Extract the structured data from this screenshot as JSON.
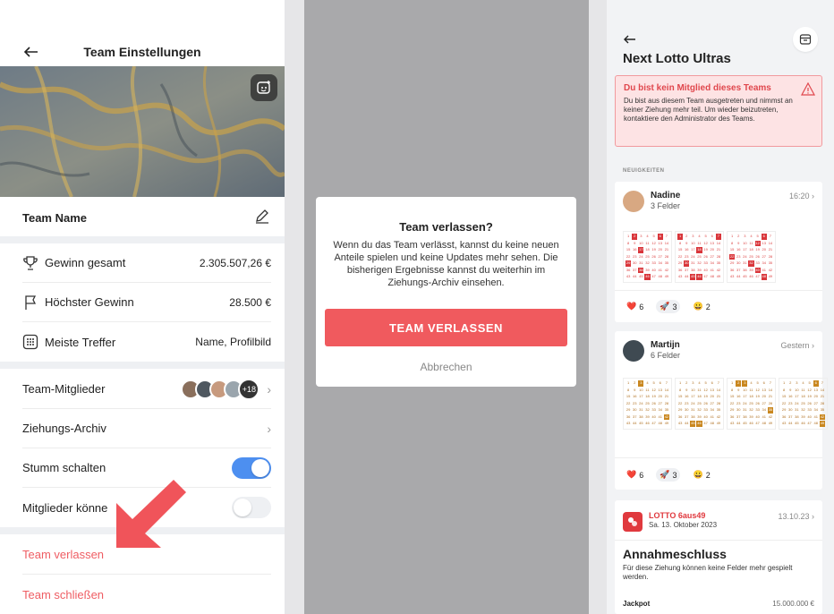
{
  "settings": {
    "title": "Team Einstellungen",
    "team_name_label": "Team Name",
    "stats": [
      {
        "label": "Gewinn gesamt",
        "value": "2.305.507,26 €"
      },
      {
        "label": "Höchster Gewinn",
        "value": "28.500 €"
      },
      {
        "label": "Meiste Treffer",
        "value": "Name, Profilbild"
      }
    ],
    "members_label": "Team-Mitglieder",
    "members_more": "+18",
    "archive_label": "Ziehungs-Archiv",
    "mute_label": "Stumm schalten",
    "mute_on": true,
    "members_can_label": "Mitglieder könne",
    "members_can_on": false,
    "leave_label": "Team verlassen",
    "close_label": "Team schließen"
  },
  "dialog": {
    "title": "Team verlassen?",
    "text": "Wenn du das Team verlässt, kannst du keine neuen Anteile spielen und keine Updates mehr sehen. Die bisherigen Ergebnisse kannst du weiterhin im Ziehungs-Archiv einsehen.",
    "confirm_label": "TEAM VERLASSEN",
    "cancel_label": "Abbrechen"
  },
  "team_view": {
    "title": "Next Lotto Ultras",
    "warning_title": "Du bist kein Mitglied dieses Teams",
    "warning_text": "Du bist aus diesem Team ausgetreten und nimmst an keiner Ziehung mehr teil. Um wieder beizutreten, kontaktiere den Administrator des Teams.",
    "news_label": "NEUIGKEITEN",
    "posts": [
      {
        "name": "Nadine",
        "sub": "3 Felder",
        "time": "16:20",
        "reactions": [
          {
            "emoji": "❤️",
            "count": "6"
          },
          {
            "emoji": "🚀",
            "count": "3"
          },
          {
            "emoji": "😀",
            "count": "2"
          }
        ]
      },
      {
        "name": "Martijn",
        "sub": "6 Felder",
        "time": "Gestern",
        "reactions": [
          {
            "emoji": "❤️",
            "count": "6"
          },
          {
            "emoji": "🚀",
            "count": "3"
          },
          {
            "emoji": "😀",
            "count": "2"
          }
        ]
      }
    ],
    "lotto": {
      "name": "LOTTO 6aus49",
      "date": "Sa. 13. Oktober 2023",
      "time": "13.10.23",
      "close_title": "Annahmeschluss",
      "close_text": "Für diese Ziehung können keine Felder mehr gespielt werden.",
      "jackpot_label": "Jackpot",
      "jackpot_value": "15.000.000 €"
    }
  },
  "colors": {
    "accent": "#f05a5e",
    "toggle_on": "#4d8ff0",
    "warning_bg": "#fde3e4"
  }
}
